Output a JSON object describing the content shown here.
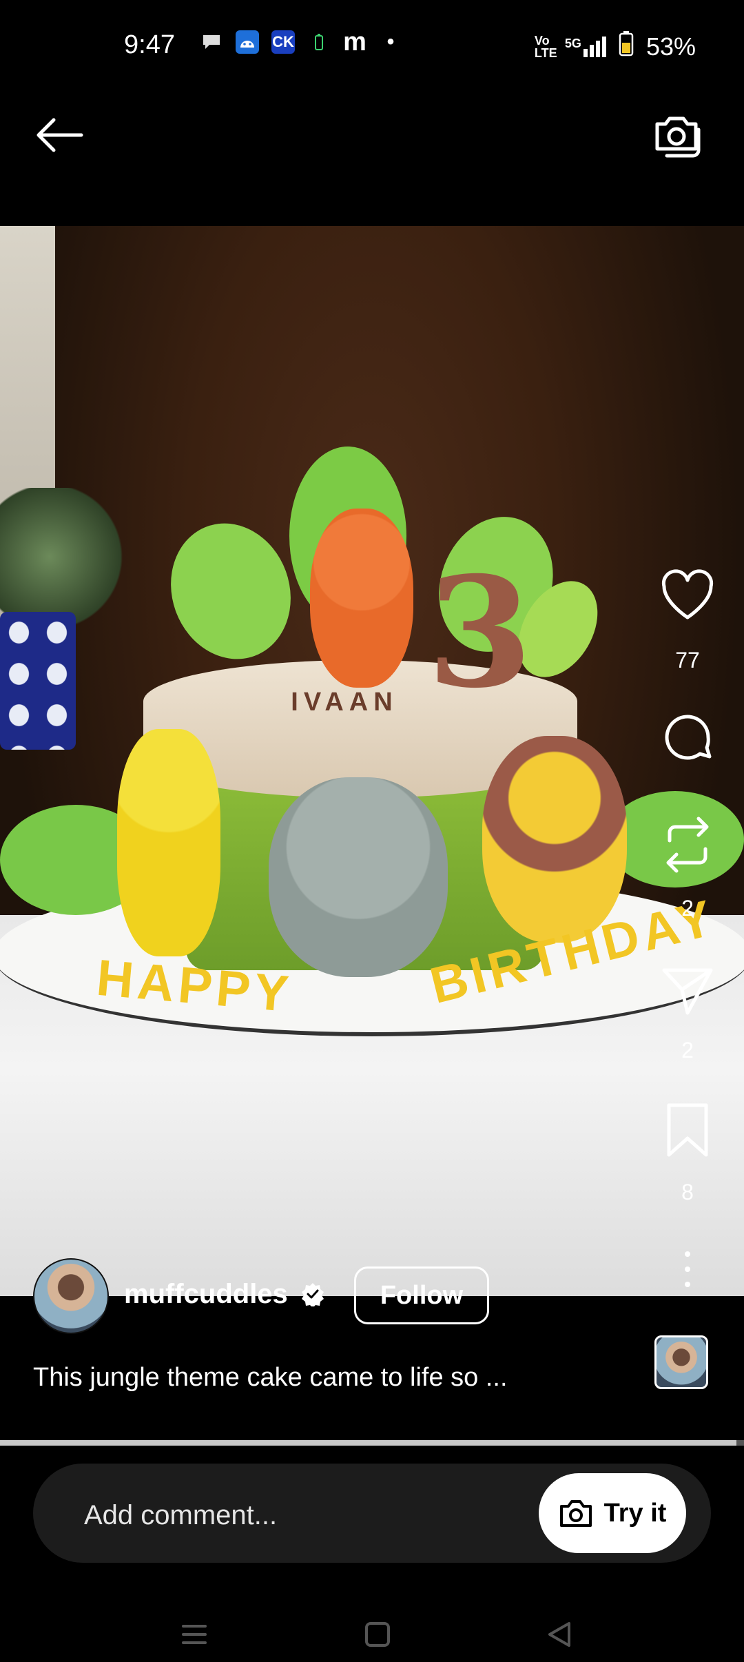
{
  "status_bar": {
    "time": "9:47",
    "battery": "53%",
    "network": "5G",
    "volte": "Vo LTE",
    "ck_badge": "CK",
    "m_icon": "m",
    "dot": "•"
  },
  "top_bar": {
    "back_icon": "back-arrow-icon",
    "camera_icon": "camera-icon"
  },
  "media": {
    "cake_name_text": "IVAAN",
    "cake_number": "3",
    "cake_happy": "HAPPY",
    "cake_birthday": "BIRTHDAY"
  },
  "actions": {
    "likes": "77",
    "reposts": "2",
    "shares": "2",
    "saves": "8"
  },
  "post": {
    "username": "muffcuddles",
    "follow_label": "Follow",
    "caption": "This jungle theme cake came to life so ..."
  },
  "progress": {
    "value": 0.99
  },
  "comment": {
    "placeholder": "Add comment...",
    "try_label": "Try it"
  }
}
